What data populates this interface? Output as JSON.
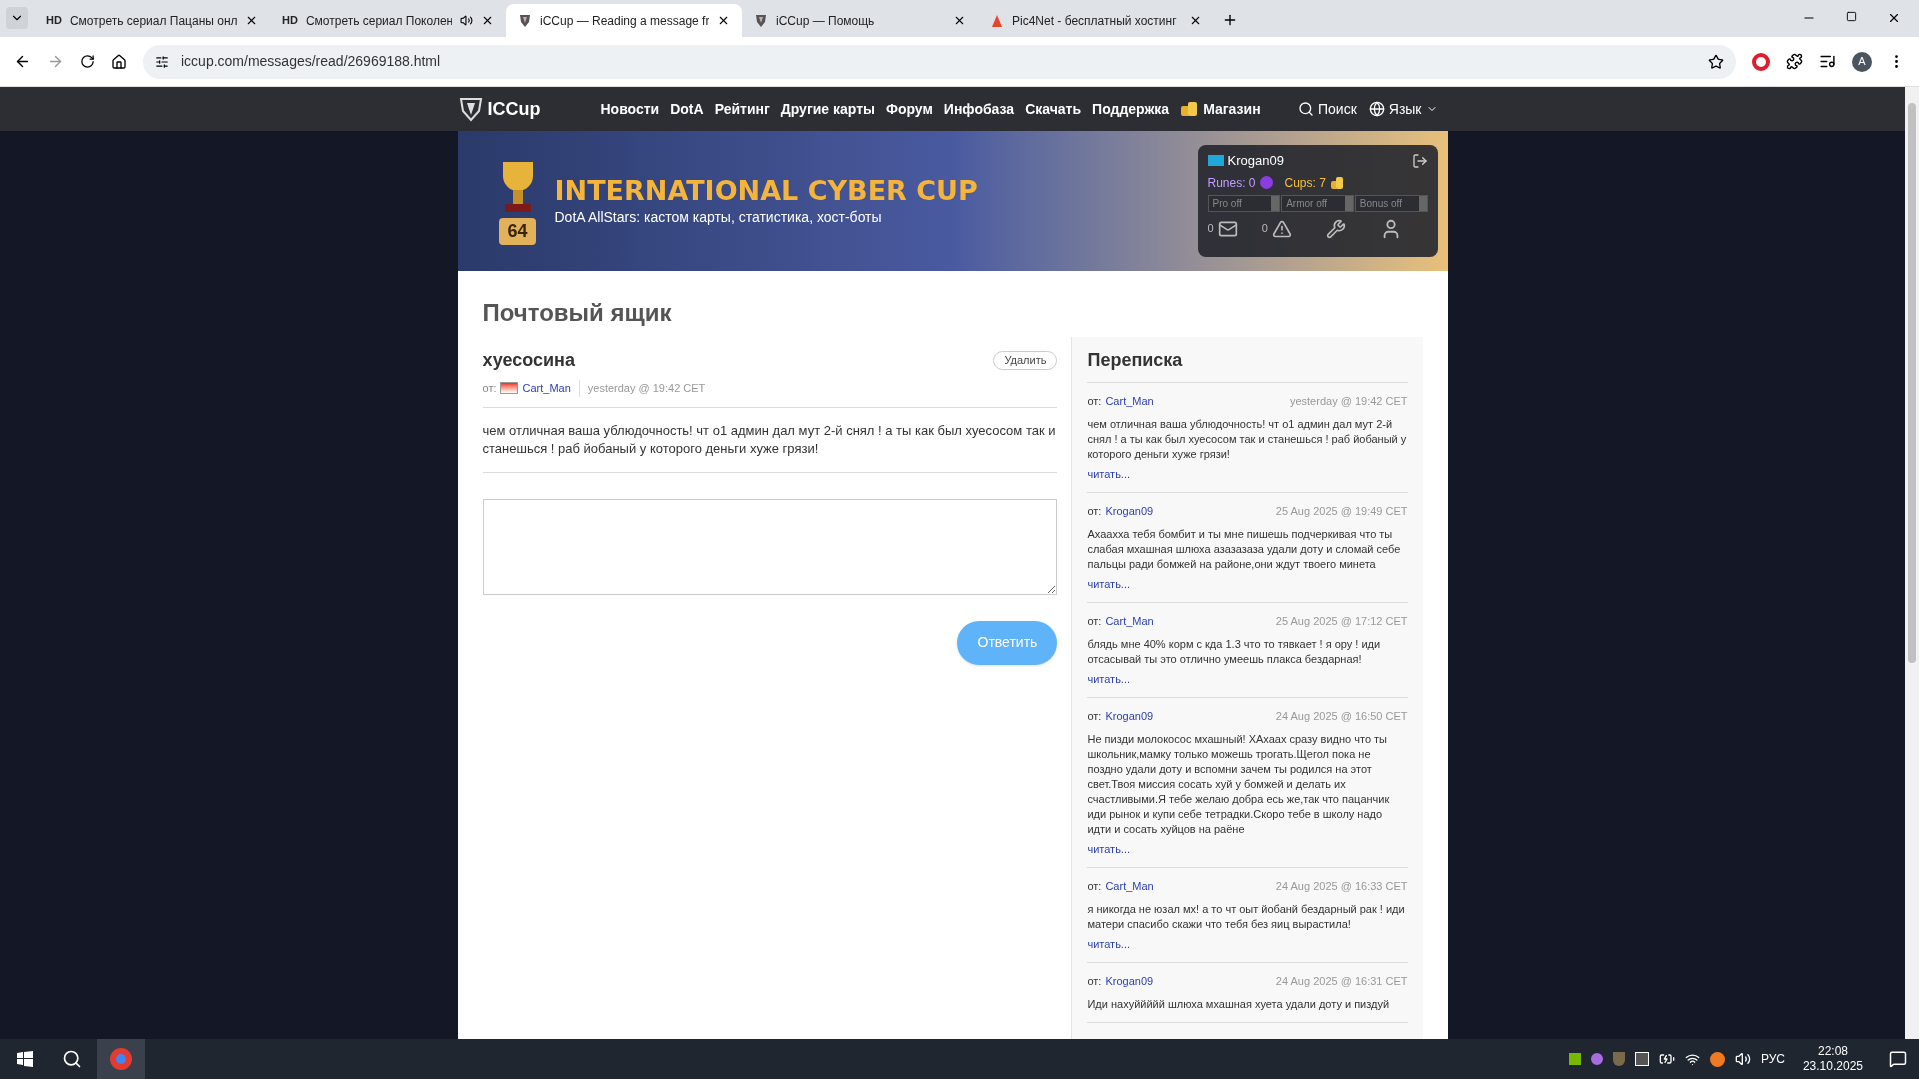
{
  "browser": {
    "tabs": [
      {
        "kind": "badge",
        "badge": "HD",
        "label": "Смотреть сериал Пацаны онл",
        "selected": false,
        "audio": false
      },
      {
        "kind": "badge",
        "badge": "HD",
        "label": "Смотреть сериал Поколен",
        "selected": false,
        "audio": true
      },
      {
        "kind": "shield",
        "label": "iCCup — Reading a message fr",
        "selected": true,
        "audio": false
      },
      {
        "kind": "shield",
        "label": "iCCup — Помощь",
        "selected": false,
        "audio": false
      },
      {
        "kind": "flame",
        "label": "Pic4Net - бесплатный хостинг",
        "selected": false,
        "audio": false
      }
    ],
    "address": "iccup.com/messages/read/26969188.html",
    "profile": "A"
  },
  "site": {
    "logo": "ICCup",
    "nav": [
      "Новости",
      "DotA",
      "Рейтинг",
      "Другие карты",
      "Форум",
      "Инфобаза",
      "Скачать",
      "Поддержка"
    ],
    "shop": "Магазин",
    "search": "Поиск",
    "language": "Язык"
  },
  "banner": {
    "title": "INTERNATIONAL CYBER CUP",
    "subtitle": "DotA AllStars: кастом карты, статистика, хост-боты",
    "badge": "64",
    "user": {
      "name": "Krogan09",
      "runes": "Runes: 0",
      "cups": "Cups: 7",
      "toggles": [
        {
          "label": "Pro off",
          "on": false
        },
        {
          "label": "Armor off",
          "on": false
        },
        {
          "label": "Bonus off",
          "on": false
        }
      ],
      "messages": "0",
      "warnings": "0"
    }
  },
  "mailbox": {
    "title": "Почтовый ящик",
    "message": {
      "subject": "хуесосина",
      "delete": "Удалить",
      "from_label": "от:",
      "sender": "Cart_Man",
      "time": "yesterday @ 19:42 CET",
      "body": "чем отличная ваша ублюдочность! чт о1 админ дал мут 2-й снял ! а ты как был хуесосом так и станешься ! раб йобаный у которого деньги хуже грязи!"
    },
    "reply": "Ответить"
  },
  "thread": {
    "title": "Переписка",
    "items": [
      {
        "from_label": "от:",
        "sender": "Cart_Man",
        "time": "yesterday @ 19:42 CET",
        "body": "чем отличная ваша ублюдочность! чт о1 админ дал мут 2-й снял ! а ты как был хуесосом так и станешься ! раб йобаный у которого деньги хуже грязи!",
        "read": "читать..."
      },
      {
        "from_label": "от:",
        "sender": "Krogan09",
        "time": "25 Aug 2025 @ 19:49 CET",
        "body": "Ахааxха тебя бомбит и ты мне пишешь подчеркивая что ты слабая мхашная шлюха азазазаза удали доту и сломай себе пальцы ради бомжей на районе,они ждут твоего минета",
        "read": "читать..."
      },
      {
        "from_label": "от:",
        "sender": "Cart_Man",
        "time": "25 Aug 2025 @ 17:12 CET",
        "body": "блядь мне 40% корм с кда 1.3 что то тявкает ! я ору ! иди отсасывай ты это отлично умеешь плакса бездарная!",
        "read": "читать..."
      },
      {
        "from_label": "от:",
        "sender": "Krogan09",
        "time": "24 Aug 2025 @ 16:50 CET",
        "body": "Не пизди молокосос мхашный! ХАхаах сразу видно что ты школьник,мамку только можешь трогать.Щегол пока не поздно удали доту и вспомни зачем ты родился на этот свет.Твоя миссия сосать хуй у бомжей и делать их счастливыми.Я тебе желаю добра есь же,так что пацанчик иди рынок и купи себе тетрадки.Скоро тебе в школу надо идти и сосать хуйцов на раёне",
        "read": "читать..."
      },
      {
        "from_label": "от:",
        "sender": "Cart_Man",
        "time": "24 Aug 2025 @ 16:33 CET",
        "body": "я никогда не юзал мх! а то чт оыт йобанй бездарный рак ! иди матери спасибо скажи что тебя без яиц вырастила!",
        "read": "читать..."
      },
      {
        "from_label": "от:",
        "sender": "Krogan09",
        "time": "24 Aug 2025 @ 16:31 CET",
        "body": "Иди нахуййййй шлюха мхашная хуета удали доту и пиздуй"
      }
    ]
  },
  "taskbar": {
    "language": "РУС",
    "time": "22:08",
    "date": "23.10.2025"
  }
}
